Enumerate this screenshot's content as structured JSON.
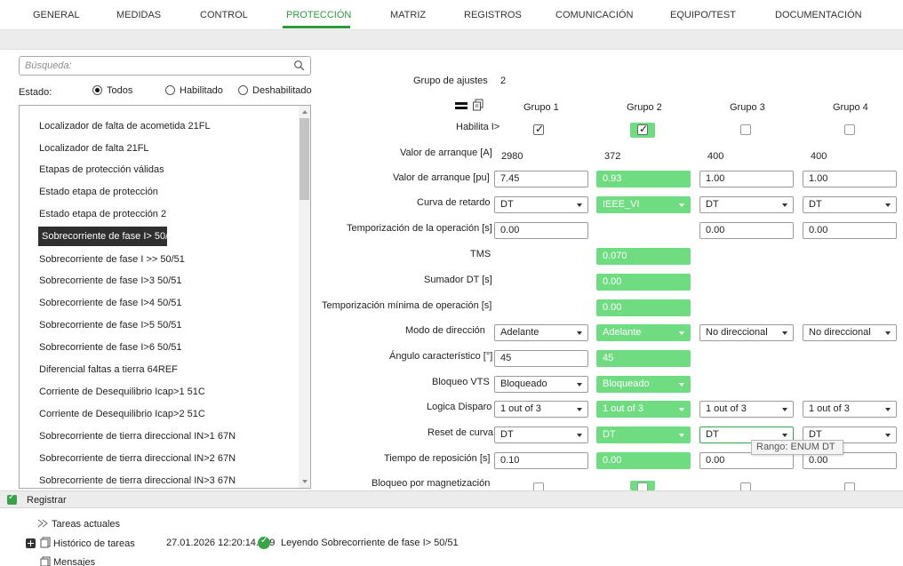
{
  "nav": {
    "tabs": [
      "GENERAL",
      "MEDIDAS",
      "CONTROL",
      "PROTECCIÓN",
      "MATRIZ",
      "REGISTROS",
      "COMUNICACIÓN",
      "EQUIPO/TEST",
      "DOCUMENTACIÓN"
    ],
    "active_tab": "PROTECCIÓN",
    "accent_color": "#2e9a3e"
  },
  "left": {
    "search_placeholder": "Búsqueda:",
    "estado_label": "Estado:",
    "radio_todos": "Todos",
    "radio_habilitado": "Habilitado",
    "radio_deshabilitado": "Deshabilitado",
    "selected_radio": "Todos",
    "items": [
      "Localizador de falta de acometida    21FL",
      "Localizador de falta     21FL",
      "Etapas de protección válidas",
      "Estado etapa de protección",
      "Estado etapa de protección 2",
      "Sobrecorriente de fase I> 50/51",
      "Sobrecorriente de fase I >> 50/51",
      "Sobrecorriente de fase I>3 50/51",
      "Sobrecorriente de fase I>4 50/51",
      "Sobrecorriente de fase I>5 50/51",
      "Sobrecorriente de fase I>6 50/51",
      "Diferencial faltas a tierra 64REF",
      "Corriente de Desequilibrio  Icap>1  51C",
      "Corriente de Desequilibrio  Icap>2  51C",
      "Sobrecorriente de tierra direccional IN>1 67N",
      "Sobrecorriente de tierra direccional IN>2 67N",
      "Sobrecorriente de tierra direccional IN>3 67N"
    ],
    "selected_item": "Sobrecorriente de fase I> 50/51"
  },
  "settings": {
    "grupo_ajustes_label": "Grupo de ajustes",
    "grupo_ajustes_value": "2",
    "groups": [
      "Grupo 1",
      "Grupo 2",
      "Grupo 3",
      "Grupo 4"
    ],
    "rows": {
      "habilita": "Habilita I>",
      "valor_a": "Valor de arranque [A]",
      "valor_pu": "Valor de arranque [pu]",
      "curva": "Curva de retardo",
      "temp_op": "Temporización de la operación [s]",
      "tms": "TMS",
      "sumador": "Sumador DT [s]",
      "temp_min": "Temporización mínima de operación [s]",
      "modo": "Modo de dirección",
      "angulo": "Ángulo característico [°]",
      "bloqueo_vts": "Bloqueo VTS",
      "logica": "Logica Disparo",
      "reset": "Reset de curva",
      "tiempo_rep": "Tiempo de reposición [s]",
      "bloqueo_mag": "Bloqueo por magnetización"
    },
    "g1": {
      "habilita": true,
      "valor_a": "2980",
      "valor_pu": "7.45",
      "curva": "DT",
      "temp_op": "0.00",
      "modo": "Adelante",
      "angulo": "45",
      "bloqueo_vts": "Bloqueado",
      "logica": "1 out of 3",
      "reset": "DT",
      "tiempo_rep": "0.10",
      "bloqueo_mag": false
    },
    "g2": {
      "habilita": true,
      "valor_a": "372",
      "valor_pu": "0.93",
      "curva": "IEEE_VI",
      "tms": "0.070",
      "sumador": "0.00",
      "temp_min": "0.00",
      "modo": "Adelante",
      "angulo": "45",
      "bloqueo_vts": "Bloqueado",
      "logica": "1 out of 3",
      "reset": "DT",
      "tiempo_rep": "0.00",
      "bloqueo_mag": false
    },
    "g3": {
      "habilita": false,
      "valor_a": "400",
      "valor_pu": "1.00",
      "curva": "DT",
      "temp_op": "0.00",
      "modo": "No direccional",
      "logica": "1 out of 3",
      "reset": "DT",
      "tiempo_rep": "0.00",
      "bloqueo_mag": false
    },
    "g4": {
      "habilita": false,
      "valor_a": "400",
      "valor_pu": "1.00",
      "curva": "DT",
      "temp_op": "0.00",
      "modo": "No direccional",
      "logica": "1 out of 3",
      "reset": "DT",
      "tiempo_rep": "0.00",
      "bloqueo_mag": false
    },
    "tooltip": "Rango: ENUM  DT",
    "highlight_color": "#6fdc82"
  },
  "bottom": {
    "title": "Registrar",
    "tareas_actuales": "Tareas actuales",
    "historico": "Histórico de tareas",
    "timestamp": "27.01.2026 12:20:14.959",
    "message": "Leyendo Sobrecorriente de fase I> 50/51",
    "mensajes": "Mensajes"
  }
}
